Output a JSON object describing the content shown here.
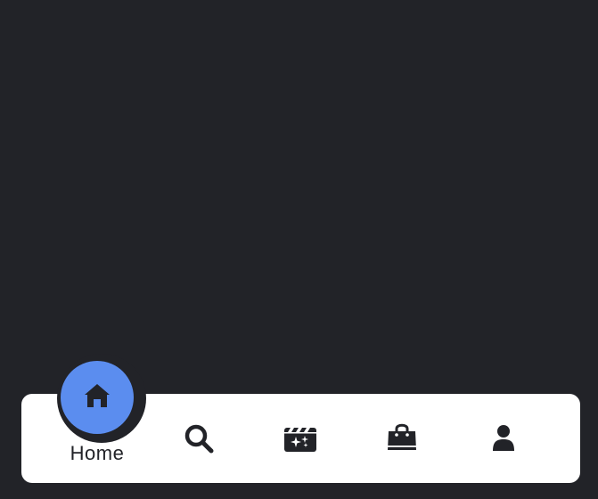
{
  "nav": {
    "items": [
      {
        "id": "home",
        "label": "Home",
        "icon": "home-icon",
        "active": true
      },
      {
        "id": "search",
        "label": "",
        "icon": "search-icon",
        "active": false
      },
      {
        "id": "reels",
        "label": "",
        "icon": "clapperboard-icon",
        "active": false
      },
      {
        "id": "shop",
        "label": "",
        "icon": "shopping-bag-icon",
        "active": false
      },
      {
        "id": "profile",
        "label": "",
        "icon": "user-icon",
        "active": false
      }
    ],
    "colors": {
      "background": "#222328",
      "bar": "#ffffff",
      "accent": "#5b8def",
      "icon": "#222328"
    }
  }
}
